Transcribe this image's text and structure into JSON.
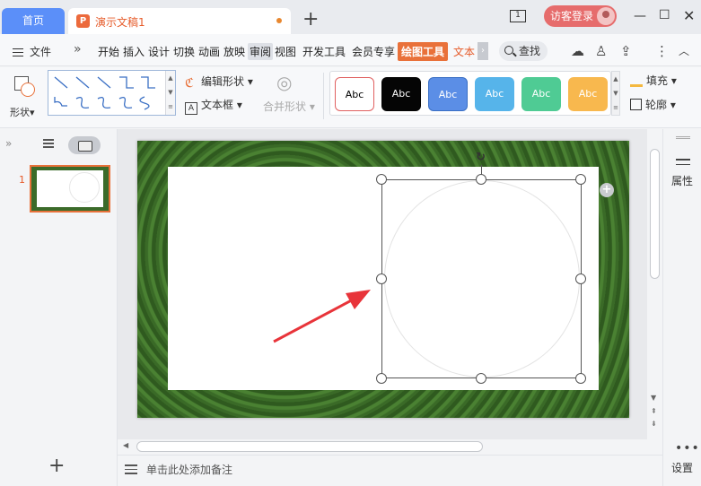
{
  "titlebar": {
    "home_tab": "首页",
    "doc_tab": "演示文稿1",
    "doc_icon": "P",
    "new_tab": "+",
    "box_icon_text": "1",
    "login_label": "访客登录"
  },
  "menubar": {
    "file_label": "文件",
    "items": [
      "开始",
      "插入",
      "设计",
      "切换",
      "动画",
      "放映",
      "审阅",
      "视图",
      "开发工具",
      "会员专享",
      "绘图工具",
      "文本"
    ],
    "search_label": "查找"
  },
  "ribbon": {
    "shape_label": "形状",
    "edit_shape_label": "编辑形状",
    "textbox_label": "文本框",
    "merge_shape_label": "合并形状",
    "style_samples": [
      "Abc",
      "Abc",
      "Abc",
      "Abc",
      "Abc",
      "Abc"
    ],
    "style_colors": [
      "#ffffff",
      "#000000",
      "#5b8ee6",
      "#56b4ea",
      "#4fcb94",
      "#f8b84e"
    ],
    "fill_label": "填充",
    "outline_label": "轮廓"
  },
  "left_panel": {
    "slide_number": "1",
    "add_slide": "+"
  },
  "notes": {
    "placeholder": "单击此处添加备注"
  },
  "right_panel": {
    "properties_label": "属性",
    "settings_label": "设置",
    "more_dots": "•••"
  },
  "colors": {
    "accent_orange": "#e8713a",
    "home_tab_blue": "#5b8ff9",
    "arrow_red": "#e8343a"
  }
}
